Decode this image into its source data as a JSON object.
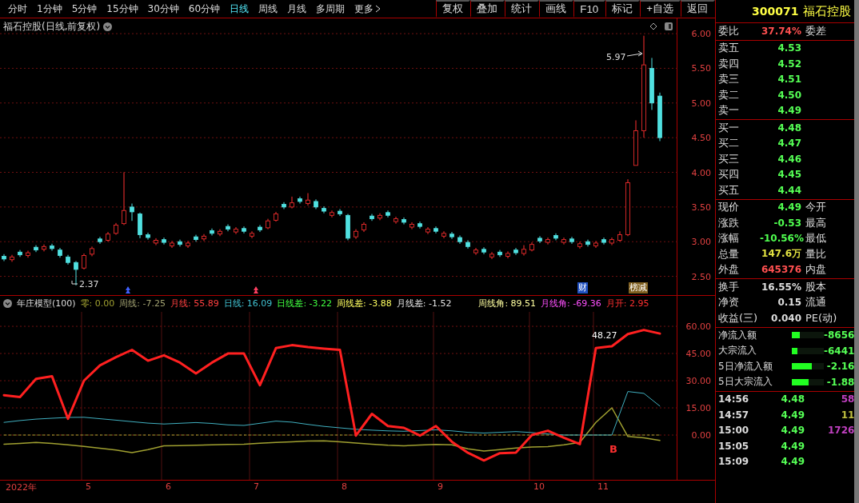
{
  "toolbar": {
    "periods": [
      {
        "label": "分时",
        "selected": false
      },
      {
        "label": "1分钟",
        "selected": false
      },
      {
        "label": "5分钟",
        "selected": false
      },
      {
        "label": "15分钟",
        "selected": false
      },
      {
        "label": "30分钟",
        "selected": false
      },
      {
        "label": "60分钟",
        "selected": false
      },
      {
        "label": "日线",
        "selected": true
      },
      {
        "label": "周线",
        "selected": false
      },
      {
        "label": "月线",
        "selected": false
      },
      {
        "label": "多周期",
        "selected": false
      },
      {
        "label": "更多",
        "selected": false
      }
    ],
    "actions": [
      "复权",
      "叠加",
      "统计",
      "画线",
      "F10",
      "标记",
      "+自选",
      "返回"
    ]
  },
  "stock": {
    "code": "300071",
    "name": "福石控股"
  },
  "price_chart": {
    "title": "福石控股(日线,前复权)",
    "high_label": "5.97",
    "low_label": "2.37",
    "chart_data": {
      "type": "candlestick",
      "grid": true,
      "ylim": [
        2.23,
        6.22
      ],
      "yticks": [
        {
          "value": 6,
          "label": "6.00"
        },
        {
          "value": 5.5,
          "label": "5.50"
        },
        {
          "value": 5,
          "label": "5.00"
        },
        {
          "value": 4.5,
          "label": "4.50"
        },
        {
          "value": 4,
          "label": "4.00"
        },
        {
          "value": 3.5,
          "label": "3.50"
        },
        {
          "value": 3,
          "label": "3.00"
        },
        {
          "value": 2.5,
          "label": "2.50"
        }
      ],
      "ohlc": [
        [
          2.79,
          2.82,
          2.72,
          2.75
        ],
        [
          2.74,
          2.81,
          2.71,
          2.78
        ],
        [
          2.85,
          2.88,
          2.78,
          2.81
        ],
        [
          2.8,
          2.87,
          2.77,
          2.84
        ],
        [
          2.92,
          2.95,
          2.85,
          2.88
        ],
        [
          2.89,
          2.96,
          2.86,
          2.93
        ],
        [
          2.94,
          2.97,
          2.87,
          2.9
        ],
        [
          2.88,
          2.91,
          2.77,
          2.8
        ],
        [
          2.78,
          2.81,
          2.67,
          2.7
        ],
        [
          2.7,
          2.72,
          2.37,
          2.6
        ],
        [
          2.62,
          2.83,
          2.6,
          2.8
        ],
        [
          2.82,
          2.93,
          2.79,
          2.9
        ],
        [
          3.04,
          3.07,
          2.97,
          3.0
        ],
        [
          3.02,
          3.14,
          3.0,
          3.11
        ],
        [
          3.12,
          3.27,
          3.1,
          3.24
        ],
        [
          3.26,
          4.0,
          3.24,
          3.45
        ],
        [
          3.5,
          3.55,
          3.3,
          3.43
        ],
        [
          3.4,
          3.42,
          3.05,
          3.1
        ],
        [
          3.1,
          3.13,
          3.03,
          3.06
        ],
        [
          2.98,
          3.05,
          2.95,
          3.02
        ],
        [
          3.03,
          3.06,
          2.96,
          2.99
        ],
        [
          2.94,
          3.01,
          2.91,
          2.98
        ],
        [
          3.0,
          3.03,
          2.93,
          2.96
        ],
        [
          2.94,
          3.01,
          2.91,
          2.98
        ],
        [
          3.07,
          3.1,
          3.0,
          3.03
        ],
        [
          3.04,
          3.11,
          3.01,
          3.08
        ],
        [
          3.16,
          3.19,
          3.09,
          3.12
        ],
        [
          3.11,
          3.18,
          3.08,
          3.15
        ],
        [
          3.22,
          3.25,
          3.15,
          3.18
        ],
        [
          3.14,
          3.21,
          3.11,
          3.18
        ],
        [
          3.19,
          3.22,
          3.12,
          3.15
        ],
        [
          3.08,
          3.15,
          3.05,
          3.12
        ],
        [
          3.21,
          3.24,
          3.14,
          3.17
        ],
        [
          3.2,
          3.33,
          3.18,
          3.3
        ],
        [
          3.31,
          3.43,
          3.29,
          3.4
        ],
        [
          3.54,
          3.57,
          3.47,
          3.5
        ],
        [
          3.5,
          3.65,
          3.48,
          3.56
        ],
        [
          3.62,
          3.65,
          3.55,
          3.58
        ],
        [
          3.55,
          3.7,
          3.52,
          3.6
        ],
        [
          3.58,
          3.61,
          3.47,
          3.5
        ],
        [
          3.48,
          3.51,
          3.41,
          3.44
        ],
        [
          3.38,
          3.45,
          3.35,
          3.42
        ],
        [
          3.44,
          3.47,
          3.37,
          3.4
        ],
        [
          3.38,
          3.4,
          3.02,
          3.05
        ],
        [
          3.07,
          3.18,
          3.04,
          3.15
        ],
        [
          3.17,
          3.28,
          3.14,
          3.25
        ],
        [
          3.37,
          3.4,
          3.3,
          3.33
        ],
        [
          3.34,
          3.41,
          3.31,
          3.38
        ],
        [
          3.42,
          3.45,
          3.35,
          3.38
        ],
        [
          3.29,
          3.36,
          3.26,
          3.33
        ],
        [
          3.32,
          3.35,
          3.25,
          3.28
        ],
        [
          3.21,
          3.28,
          3.18,
          3.25
        ],
        [
          3.26,
          3.29,
          3.19,
          3.22
        ],
        [
          3.14,
          3.21,
          3.11,
          3.18
        ],
        [
          3.19,
          3.22,
          3.12,
          3.15
        ],
        [
          3.08,
          3.15,
          3.05,
          3.12
        ],
        [
          3.11,
          3.14,
          3.04,
          3.07
        ],
        [
          3.06,
          3.09,
          2.97,
          3.0
        ],
        [
          2.99,
          3.02,
          2.9,
          2.93
        ],
        [
          2.84,
          2.91,
          2.81,
          2.88
        ],
        [
          2.89,
          2.92,
          2.82,
          2.85
        ],
        [
          2.78,
          2.85,
          2.75,
          2.82
        ],
        [
          2.85,
          2.88,
          2.78,
          2.81
        ],
        [
          2.79,
          2.86,
          2.76,
          2.83
        ],
        [
          2.88,
          2.91,
          2.81,
          2.84
        ],
        [
          2.83,
          2.95,
          2.8,
          2.89
        ],
        [
          2.88,
          2.99,
          2.86,
          2.96
        ],
        [
          3.05,
          3.08,
          2.98,
          3.01
        ],
        [
          2.99,
          3.06,
          2.96,
          3.03
        ],
        [
          3.09,
          3.12,
          3.02,
          3.05
        ],
        [
          2.99,
          3.06,
          2.96,
          3.03
        ],
        [
          3.04,
          3.07,
          2.97,
          3.0
        ],
        [
          2.93,
          3.0,
          2.9,
          2.97
        ],
        [
          3.0,
          3.03,
          2.93,
          2.96
        ],
        [
          2.94,
          3.01,
          2.91,
          2.98
        ],
        [
          3.03,
          3.06,
          2.96,
          2.99
        ],
        [
          2.98,
          3.06,
          2.95,
          3.03
        ],
        [
          3.02,
          3.15,
          3.0,
          3.1
        ],
        [
          3.1,
          3.9,
          3.08,
          3.85
        ],
        [
          4.1,
          4.75,
          4.1,
          4.6
        ],
        [
          4.6,
          5.97,
          4.5,
          5.55
        ],
        [
          5.5,
          5.65,
          4.9,
          5.0
        ],
        [
          5.1,
          5.15,
          4.45,
          4.5
        ]
      ]
    },
    "markers": [
      {
        "label": "财",
        "kind": "finance"
      },
      {
        "label": "榜减",
        "kind": "list"
      }
    ]
  },
  "indicator": {
    "title": "年庄模型(100)",
    "legend": [
      {
        "text": "零: 0.00",
        "color": "#a0a030"
      },
      {
        "text": "周线: -7.25",
        "color": "#a0a070"
      },
      {
        "text": "月线: 55.89",
        "color": "#ff4040"
      },
      {
        "text": "日线: 16.09",
        "color": "#40c0d0"
      },
      {
        "text": "日线差: -3.22",
        "color": "#40ff40"
      },
      {
        "text": "周线差: -3.88",
        "color": "#ffff60"
      },
      {
        "text": "月线差: -1.52",
        "color": "#e0e0e0"
      },
      {
        "text": "周线角: 89.51",
        "color": "#ffffa0"
      },
      {
        "text": "月线角: -69.36",
        "color": "#ff50ff"
      },
      {
        "text": "月开: 2.95",
        "color": "#ff3030"
      }
    ],
    "chart_data": {
      "type": "line",
      "grid": true,
      "ylim": [
        -24.7,
        76.8
      ],
      "yticks": [
        {
          "value": 60,
          "label": "60.00"
        },
        {
          "value": 45,
          "label": "45.00"
        },
        {
          "value": 30,
          "label": "30.00"
        },
        {
          "value": 15,
          "label": "15.00"
        },
        {
          "value": 0,
          "label": "0.00"
        }
      ],
      "series": [
        {
          "line_style": "dashed",
          "color": "#a0a030",
          "values": [
            0,
            0,
            0,
            0,
            0,
            0,
            0,
            0,
            0,
            0,
            0,
            0,
            0,
            0,
            0,
            0,
            0,
            0,
            0,
            0,
            0,
            0,
            0,
            0,
            0,
            0,
            0,
            0,
            0,
            0,
            0,
            0,
            0,
            0,
            0,
            0,
            0,
            0,
            0,
            0,
            0,
            0
          ]
        },
        {
          "line_style": "solid",
          "color": "#a0a030",
          "values": [
            -5,
            -4.6,
            -4.1,
            -4.6,
            -5.4,
            -6.3,
            -7.3,
            -8.3,
            -9.7,
            -8,
            -6,
            -5.8,
            -5.6,
            -5.4,
            -5.2,
            -5,
            -4.5,
            -4.1,
            -3.7,
            -3.3,
            -3.2,
            -3.8,
            -4.4,
            -5,
            -5.6,
            -5.9,
            -5.5,
            -5.2,
            -5.4,
            -7.6,
            -8.8,
            -8,
            -7.2,
            -6.6,
            -6.4,
            -5.4,
            -4.1,
            7,
            15,
            -0.8,
            -1.5,
            -3
          ]
        },
        {
          "line_style": "solid",
          "color": "#40b0c0",
          "values": [
            7,
            8,
            8.8,
            9.3,
            9.7,
            9.8,
            9,
            8.2,
            7.4,
            6.6,
            6.1,
            6.5,
            6.9,
            6.4,
            5.6,
            5.3,
            6.5,
            7.7,
            7.1,
            5.9,
            4.8,
            4,
            3.2,
            2.7,
            2.3,
            2.1,
            2.5,
            2.9,
            2.3,
            1.5,
            1.1,
            1.5,
            1.9,
            1.4,
            0.6,
            0,
            0,
            0,
            0,
            24,
            23,
            16
          ]
        },
        {
          "line_style": "solid",
          "color": "#ff2020",
          "values": [
            22,
            21,
            31,
            32.5,
            9,
            30,
            38.5,
            43,
            47,
            41,
            44,
            40,
            34,
            40,
            45,
            45,
            27.5,
            48,
            49.6,
            48.5,
            47.7,
            47,
            -0.3,
            11.7,
            5,
            4,
            -0.3,
            5,
            -3.7,
            -9.8,
            -14,
            -10,
            -9.7,
            0,
            2.4,
            -1.5,
            -5,
            48,
            49,
            55.7,
            58,
            56
          ]
        }
      ]
    },
    "peak_label": "48.27",
    "signal": "B"
  },
  "time_axis": [
    "2022年",
    "5",
    "6",
    "7",
    "8",
    "9",
    "10",
    "11"
  ],
  "quote": {
    "ratio": {
      "label": "委比",
      "value": "37.74%",
      "label2": "委差",
      "color": "#ff5050"
    },
    "asks": [
      {
        "label": "卖五",
        "price": "4.53"
      },
      {
        "label": "卖四",
        "price": "4.52"
      },
      {
        "label": "卖三",
        "price": "4.51"
      },
      {
        "label": "卖二",
        "price": "4.50"
      },
      {
        "label": "卖一",
        "price": "4.49"
      }
    ],
    "bids": [
      {
        "label": "买一",
        "price": "4.48"
      },
      {
        "label": "买二",
        "price": "4.47"
      },
      {
        "label": "买三",
        "price": "4.46"
      },
      {
        "label": "买四",
        "price": "4.45"
      },
      {
        "label": "买五",
        "price": "4.44"
      }
    ],
    "stats": [
      {
        "label": "现价",
        "value": "4.49",
        "label2": "今开",
        "color": "#50ff50"
      },
      {
        "label": "涨跌",
        "value": "-0.53",
        "label2": "最高",
        "color": "#50ff50"
      },
      {
        "label": "涨幅",
        "value": "-10.56%",
        "label2": "最低",
        "color": "#50ff50"
      },
      {
        "label": "总量",
        "value": "147.6万",
        "label2": "量比",
        "color": "#e0e040"
      },
      {
        "label": "外盘",
        "value": "645376",
        "label2": "内盘",
        "color": "#ff5050"
      }
    ],
    "finance": [
      {
        "label": "换手",
        "value": "16.55%",
        "label2": "股本"
      },
      {
        "label": "净资",
        "value": "0.15",
        "label2": "流通"
      },
      {
        "label": "收益(三)",
        "value": "0.040",
        "label2": "PE(动)"
      }
    ],
    "flows": [
      {
        "label": "净流入额",
        "level": 0.25,
        "value": "-8656"
      },
      {
        "label": "大宗流入",
        "level": 0.17,
        "value": "-6441"
      },
      {
        "label": "5日净流入额",
        "level": 0.62,
        "value": "-2.16"
      },
      {
        "label": "5日大宗流入",
        "level": 0.52,
        "value": "-1.88"
      }
    ],
    "trades": [
      {
        "time": "14:56",
        "price": "4.48",
        "volume": "58",
        "color": "#c040c0"
      },
      {
        "time": "14:57",
        "price": "4.49",
        "volume": "11",
        "color": "#c0c040"
      },
      {
        "time": "15:00",
        "price": "4.49",
        "volume": "1726",
        "color": "#c040c0"
      },
      {
        "time": "15:05",
        "price": "4.49"
      },
      {
        "time": "15:09",
        "price": "4.49"
      }
    ]
  }
}
